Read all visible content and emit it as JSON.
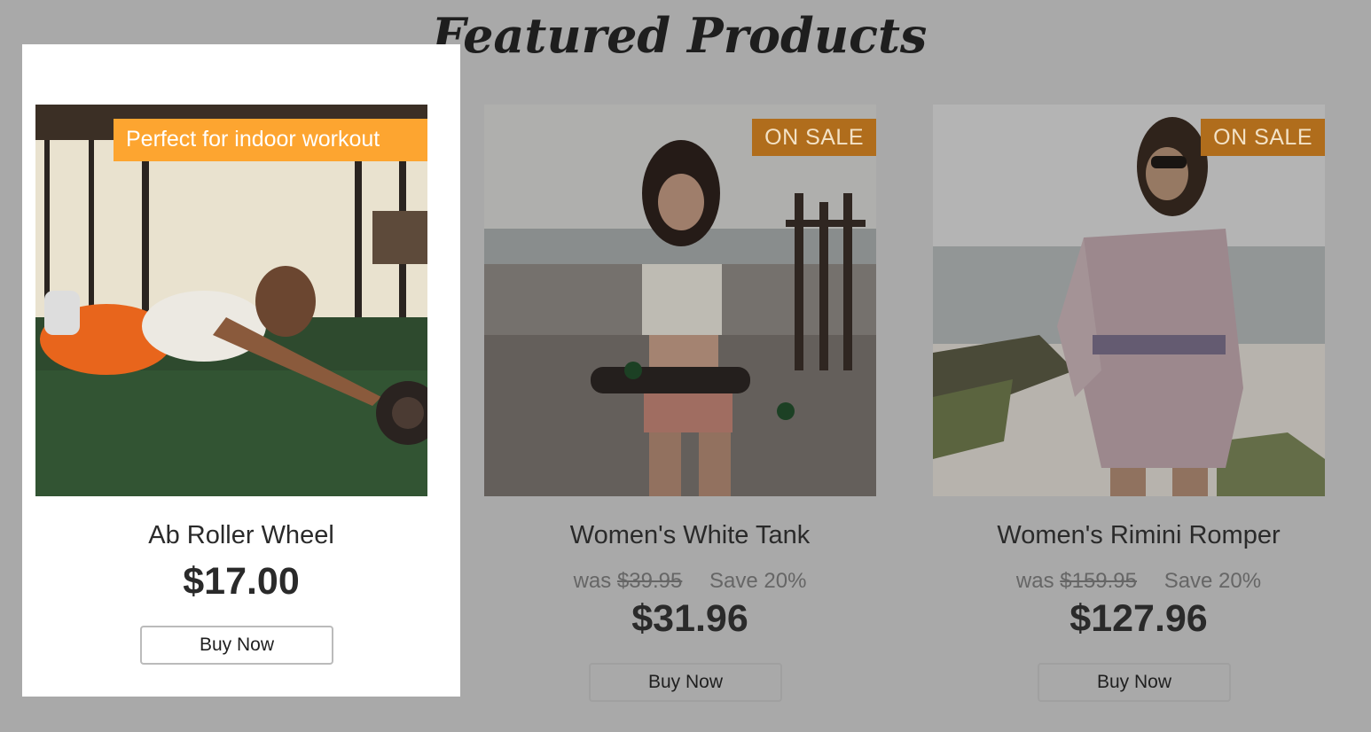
{
  "page": {
    "title": "Featured Products"
  },
  "products": [
    {
      "name": "Ab Roller Wheel",
      "promo": "Perfect for indoor workout",
      "price": "$17.00",
      "button": "Buy Now"
    },
    {
      "name": "Women's White Tank",
      "badge": "ON SALE",
      "was_label": "was",
      "was_price": "$39.95",
      "save": "Save 20%",
      "price": "$31.96",
      "button": "Buy Now"
    },
    {
      "name": "Women's Rimini Romper",
      "badge": "ON SALE",
      "was_label": "was",
      "was_price": "$159.95",
      "save": "Save 20%",
      "price": "$127.96",
      "button": "Buy Now"
    }
  ],
  "colors": {
    "background": "#a9a9a9",
    "highlight_card": "#ffffff",
    "promo_banner": "#fda530",
    "sale_badge": "#b06d1c"
  }
}
